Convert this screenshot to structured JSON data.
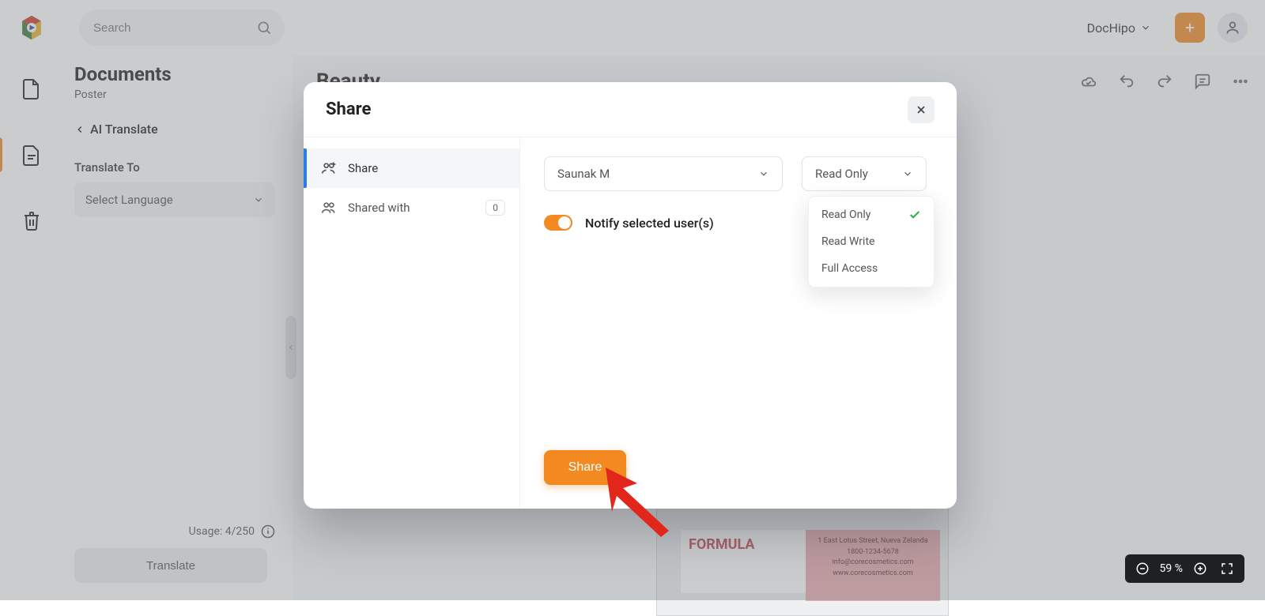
{
  "topbar": {
    "search_placeholder": "Search",
    "workspace_label": "DocHipo"
  },
  "sidepanel": {
    "title": "Documents",
    "subtitle": "Poster",
    "back_label": "AI Translate",
    "translate_to_label": "Translate To",
    "lang_placeholder": "Select Language",
    "usage_label": "Usage: 4/250",
    "translate_button": "Translate"
  },
  "canvas": {
    "doc_title": "Beauty"
  },
  "poster": {
    "word": "FORMULA",
    "addr1": "1 East Lotus Street, Nueva Zelanda",
    "addr2": "1800-1234-5678",
    "addr3": "info@corecosmetics.com",
    "addr4": "www.corecosmetics.com"
  },
  "modal": {
    "title": "Share",
    "tabs": {
      "share": "Share",
      "shared_with": "Shared with",
      "shared_count": "0"
    },
    "person_selected": "Saunak M",
    "perm_selected": "Read Only",
    "notify_label": "Notify selected user(s)",
    "share_button": "Share",
    "perm_options": [
      "Read Only",
      "Read Write",
      "Full Access"
    ]
  },
  "zoom": {
    "value": "59 %"
  }
}
